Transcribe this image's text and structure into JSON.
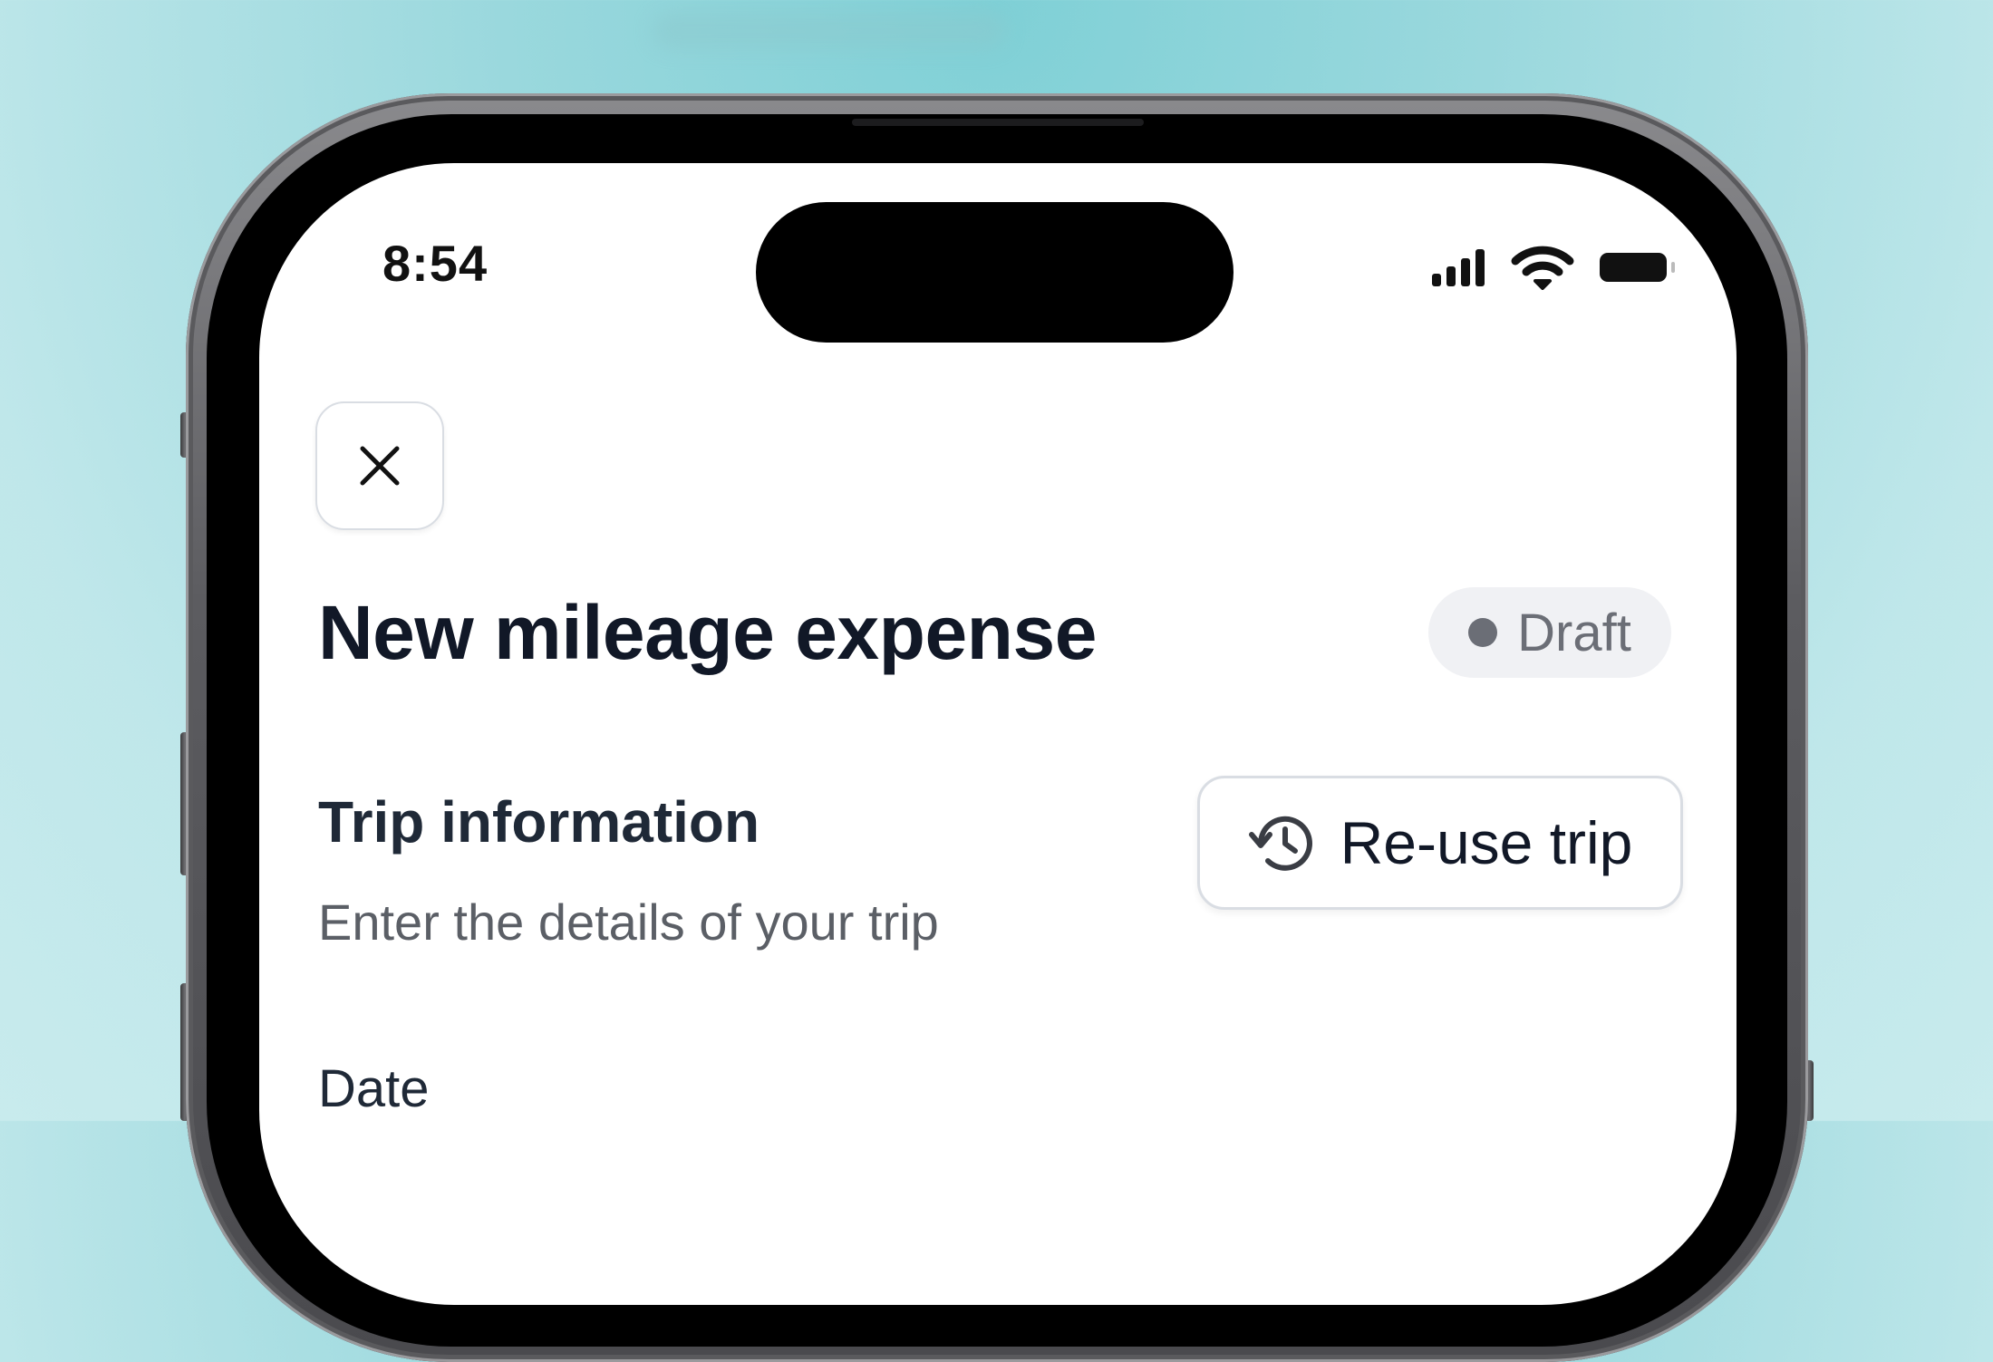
{
  "status_bar": {
    "time": "8:54",
    "icons": [
      "signal-icon",
      "wifi-icon",
      "battery-icon"
    ]
  },
  "header": {
    "close_icon": "close-icon",
    "title": "New mileage expense",
    "status_badge": "Draft"
  },
  "trip_section": {
    "title": "Trip information",
    "subtitle": "Enter the details of your trip",
    "reuse_button": "Re-use trip",
    "reuse_icon": "history-icon"
  },
  "form": {
    "date_label": "Date"
  },
  "colors": {
    "background": "#9ad8dd",
    "title_text": "#111827",
    "muted_text": "#5b5f66",
    "badge_bg": "#f0f1f4",
    "badge_text": "#6b6e76"
  }
}
